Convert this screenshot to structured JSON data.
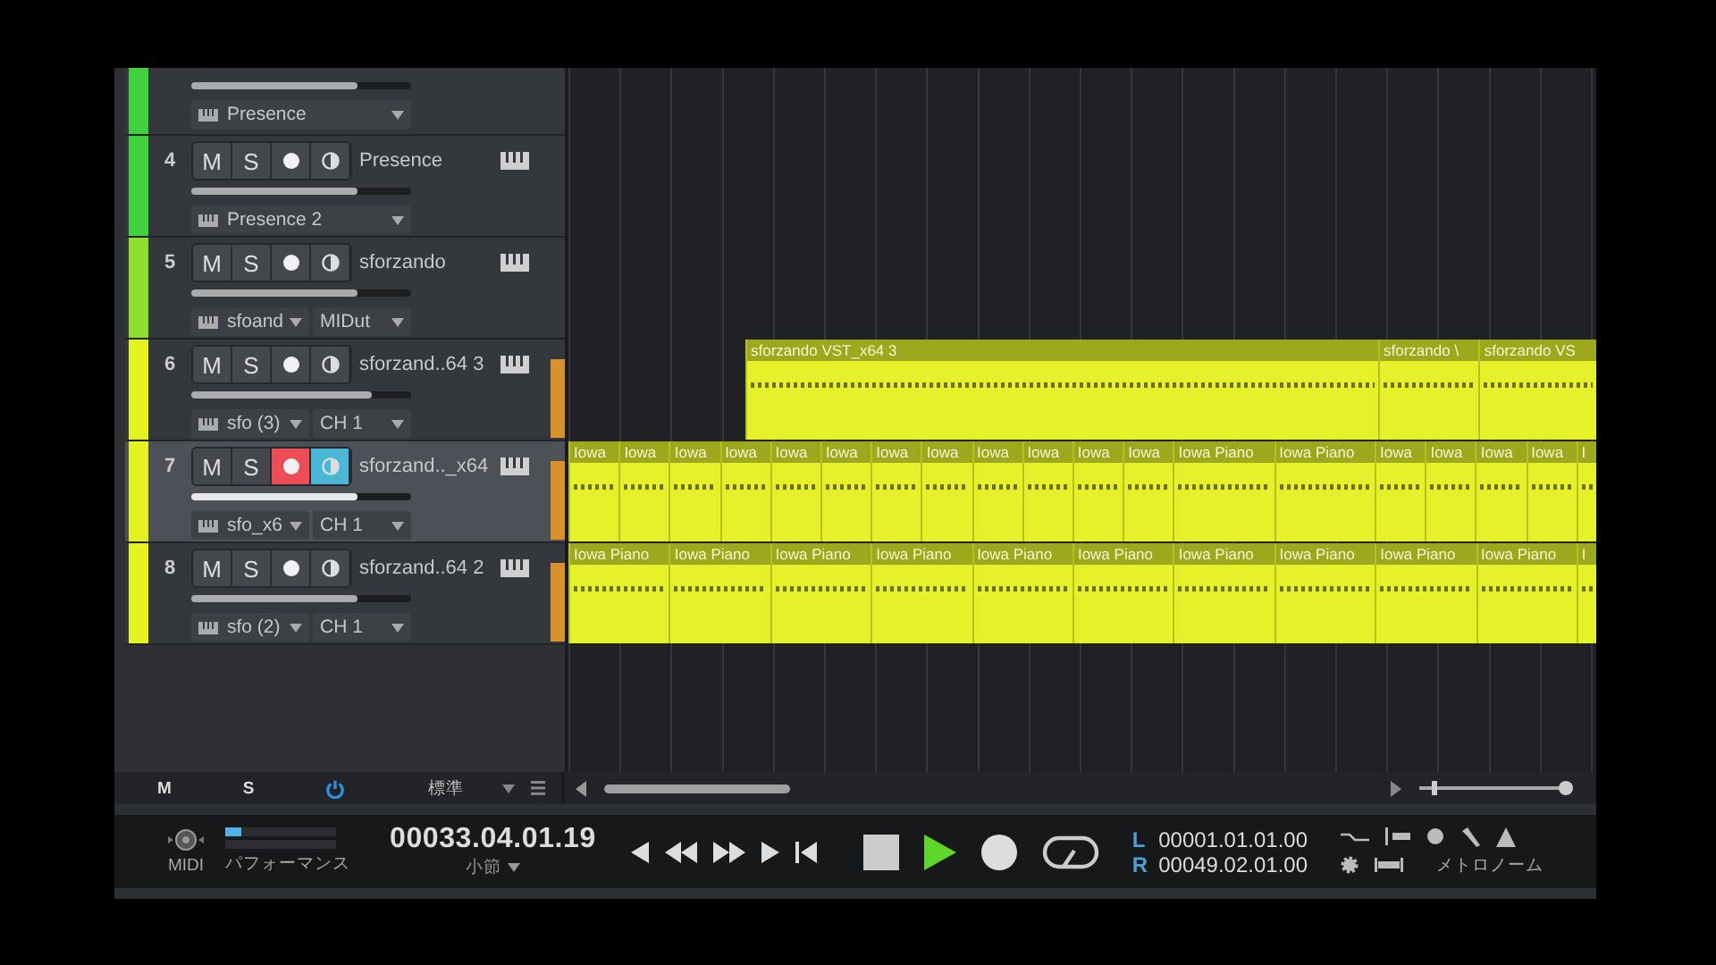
{
  "tracks": [
    {
      "kind": "partial",
      "color": "#3fd23c",
      "level": 0.76,
      "instrument": "Presence",
      "selected": false
    },
    {
      "kind": "full",
      "number": "4",
      "mute_label": "M",
      "solo_label": "S",
      "name": "Presence",
      "color": "#3fd23c",
      "level": 0.76,
      "instrument": "Presence 2",
      "record_armed": false,
      "monitor": false,
      "selected": false
    },
    {
      "kind": "full",
      "number": "5",
      "mute_label": "M",
      "solo_label": "S",
      "name": "sforzando",
      "color": "#8ddf2f",
      "level": 0.76,
      "instrument": "sfoand",
      "channel": "MIDut",
      "record_armed": false,
      "monitor": false,
      "selected": false
    },
    {
      "kind": "full",
      "number": "6",
      "mute_label": "M",
      "solo_label": "S",
      "name": "sforzand..64 3",
      "color": "#e4f222",
      "level": 0.82,
      "instrument": "sfo (3)",
      "channel": "CH 1",
      "record_armed": false,
      "monitor": false,
      "selected": false,
      "lane": [
        {
          "kind": "extended",
          "label": "sforzando VST_x64 3"
        },
        {
          "kind": "long",
          "label": "sforzando \\"
        },
        {
          "kind": "rest",
          "label": "sforzando VS"
        }
      ]
    },
    {
      "kind": "full",
      "number": "7",
      "mute_label": "M",
      "solo_label": "S",
      "name": "sforzand.._x64",
      "color": "#e4f222",
      "level": 0.76,
      "instrument": "sfo_x6",
      "channel": "CH 1",
      "record_armed": true,
      "monitor": true,
      "selected": true,
      "lane": [
        {
          "kind": "short",
          "label": "Iowa"
        },
        {
          "kind": "short",
          "label": "Iowa"
        },
        {
          "kind": "short",
          "label": "Iowa"
        },
        {
          "kind": "short",
          "label": "Iowa"
        },
        {
          "kind": "short",
          "label": "Iowa"
        },
        {
          "kind": "short",
          "label": "Iowa"
        },
        {
          "kind": "short",
          "label": "Iowa"
        },
        {
          "kind": "short",
          "label": "Iowa"
        },
        {
          "kind": "short",
          "label": "Iowa"
        },
        {
          "kind": "short",
          "label": "Iowa"
        },
        {
          "kind": "short",
          "label": "Iowa"
        },
        {
          "kind": "short",
          "label": "Iowa"
        },
        {
          "kind": "long",
          "label": "Iowa Piano"
        },
        {
          "kind": "long",
          "label": "Iowa Piano"
        },
        {
          "kind": "short",
          "label": "Iowa"
        },
        {
          "kind": "short",
          "label": "Iowa"
        },
        {
          "kind": "short",
          "label": "Iowa"
        },
        {
          "kind": "short",
          "label": "Iowa"
        },
        {
          "kind": "rest",
          "label": "I"
        }
      ]
    },
    {
      "kind": "full",
      "number": "8",
      "mute_label": "M",
      "solo_label": "S",
      "name": "sforzand..64 2",
      "color": "#e4f222",
      "level": 0.76,
      "instrument": "sfo (2)",
      "channel": "CH 1",
      "record_armed": false,
      "monitor": false,
      "selected": false,
      "lane": [
        {
          "kind": "long",
          "label": "Iowa Piano"
        },
        {
          "kind": "long",
          "label": "Iowa Piano"
        },
        {
          "kind": "long",
          "label": "Iowa Piano"
        },
        {
          "kind": "long",
          "label": "Iowa Piano"
        },
        {
          "kind": "long",
          "label": "Iowa Piano"
        },
        {
          "kind": "long",
          "label": "Iowa Piano"
        },
        {
          "kind": "long",
          "label": "Iowa Piano"
        },
        {
          "kind": "long",
          "label": "Iowa Piano"
        },
        {
          "kind": "long",
          "label": "Iowa Piano"
        },
        {
          "kind": "long",
          "label": "Iowa Piano"
        },
        {
          "kind": "rest",
          "label": "I"
        }
      ]
    }
  ],
  "footer": {
    "mute_label": "M",
    "solo_label": "S",
    "view": "標準",
    "zoom": {
      "level": 0.08
    }
  },
  "transport": {
    "midi_label": "MIDI",
    "performance": {
      "label": "パフォーマンス",
      "level": 0.15
    },
    "time": "00033.04.01.19",
    "time_format": "小節",
    "playing": true,
    "loop": false,
    "left_label": "L",
    "right_label": "R",
    "left_time": "00001.01.01.00",
    "right_time": "00049.02.01.00",
    "metronome_label": "メトロノーム"
  }
}
